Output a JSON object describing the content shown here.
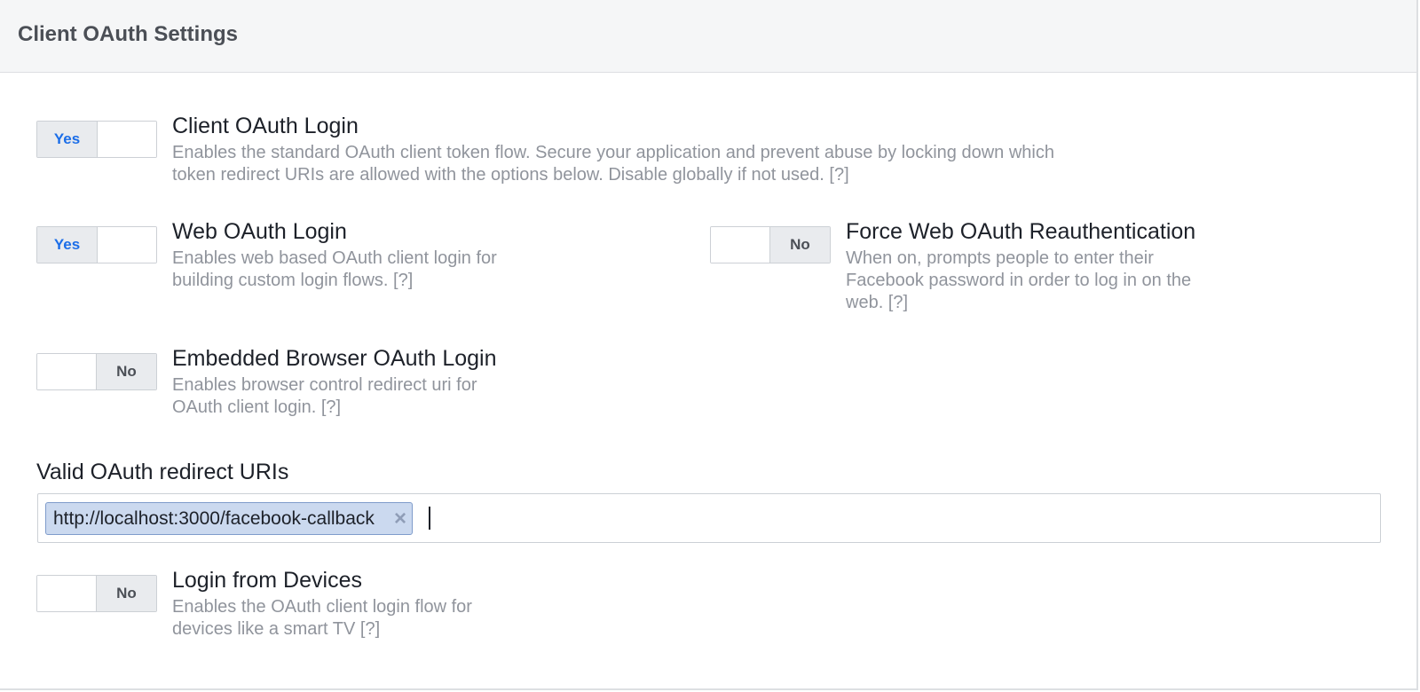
{
  "header": {
    "title": "Client OAuth Settings"
  },
  "settings": {
    "client_oauth_login": {
      "title": "Client OAuth Login",
      "description": "Enables the standard OAuth client token flow. Secure your application and prevent abuse by locking down which token redirect URIs are allowed with the options below. Disable globally if not used.  [?]",
      "toggle_label": "Yes",
      "enabled": true
    },
    "web_oauth_login": {
      "title": "Web OAuth Login",
      "description": "Enables web based OAuth client login for building custom login flows.  [?]",
      "toggle_label": "Yes",
      "enabled": true
    },
    "force_web_oauth_reauth": {
      "title": "Force Web OAuth Reauthentication",
      "description": "When on, prompts people to enter their Facebook password in order to log in on the web. [?]",
      "toggle_label": "No",
      "enabled": false
    },
    "embedded_browser_oauth_login": {
      "title": "Embedded Browser OAuth Login",
      "description": "Enables browser control redirect uri for OAuth client login.  [?]",
      "toggle_label": "No",
      "enabled": false
    },
    "login_from_devices": {
      "title": "Login from Devices",
      "description": "Enables the OAuth client login flow for devices like a smart TV [?]",
      "toggle_label": "No",
      "enabled": false
    }
  },
  "redirect_uris": {
    "label": "Valid OAuth redirect URIs",
    "tokens": [
      "http://localhost:3000/facebook-callback"
    ],
    "remove_glyph": "×"
  }
}
